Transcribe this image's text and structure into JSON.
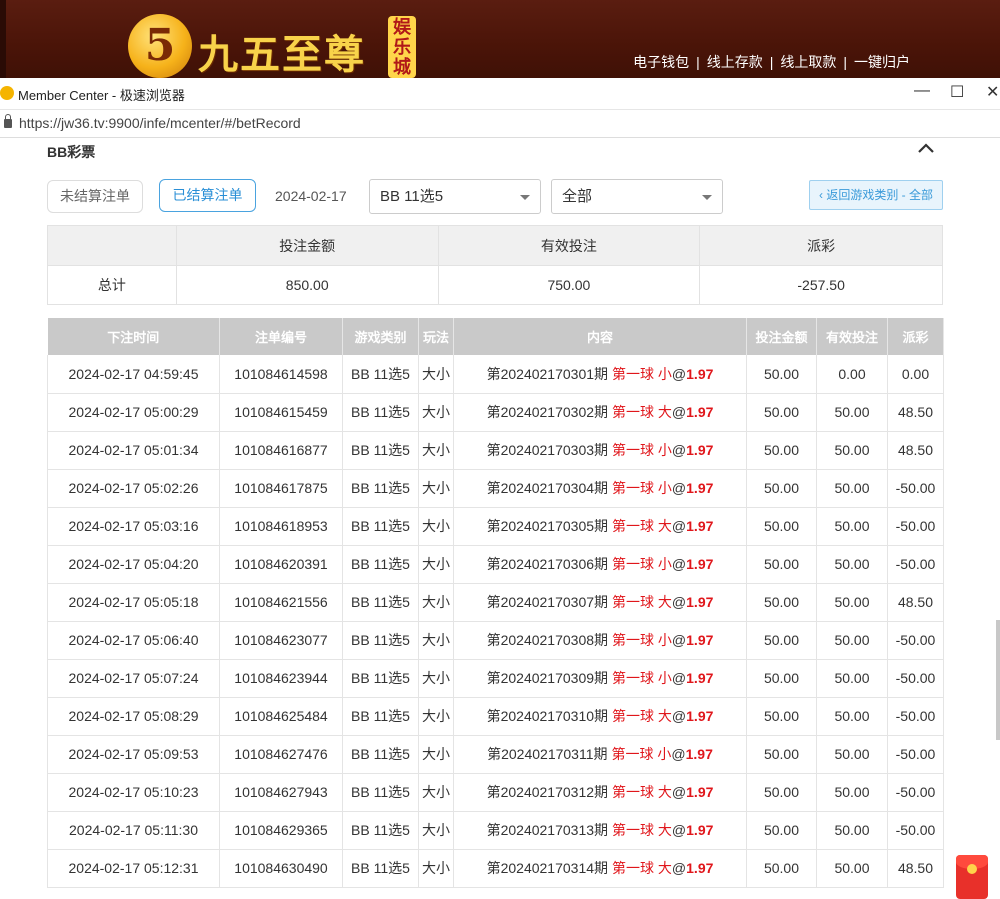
{
  "site": {
    "logo_glyph": "5",
    "brand": "九五至尊",
    "badge": "娱乐城",
    "nav": [
      "电子钱包",
      "线上存款",
      "线上取款",
      "一键归户"
    ]
  },
  "window": {
    "title": "Member Center - 极速浏览器",
    "minimize": "—",
    "maximize": "☐",
    "close": "✕",
    "url": "https://jw36.tv:9900/infe/mcenter/#/betRecord"
  },
  "section": {
    "title": "BB彩票"
  },
  "filters": {
    "unsettled_label": "未结算注单",
    "settled_label": "已结算注单",
    "date": "2024-02-17",
    "game_select": "BB 11选5",
    "type_select": "全部",
    "back_label": "‹ 返回游戏类别 - 全部"
  },
  "summary": {
    "headers": [
      "投注金额",
      "有效投注",
      "派彩"
    ],
    "row_label": "总计",
    "bet_amount": "850.00",
    "valid_bet": "750.00",
    "payout": "-257.50"
  },
  "records": {
    "headers": [
      "下注时间",
      "注单编号",
      "游戏类别",
      "玩法",
      "内容",
      "投注金额",
      "有效投注",
      "派彩"
    ],
    "rows": [
      {
        "time": "2024-02-17 04:59:45",
        "id": "101084614598",
        "game": "BB 11选5",
        "play": "大小",
        "period": "第202402170301期",
        "pick": "第一球 小",
        "odds": "1.97",
        "bet": "50.00",
        "valid": "0.00",
        "payout": "0.00"
      },
      {
        "time": "2024-02-17 05:00:29",
        "id": "101084615459",
        "game": "BB 11选5",
        "play": "大小",
        "period": "第202402170302期",
        "pick": "第一球 大",
        "odds": "1.97",
        "bet": "50.00",
        "valid": "50.00",
        "payout": "48.50"
      },
      {
        "time": "2024-02-17 05:01:34",
        "id": "101084616877",
        "game": "BB 11选5",
        "play": "大小",
        "period": "第202402170303期",
        "pick": "第一球 小",
        "odds": "1.97",
        "bet": "50.00",
        "valid": "50.00",
        "payout": "48.50"
      },
      {
        "time": "2024-02-17 05:02:26",
        "id": "101084617875",
        "game": "BB 11选5",
        "play": "大小",
        "period": "第202402170304期",
        "pick": "第一球 小",
        "odds": "1.97",
        "bet": "50.00",
        "valid": "50.00",
        "payout": "-50.00"
      },
      {
        "time": "2024-02-17 05:03:16",
        "id": "101084618953",
        "game": "BB 11选5",
        "play": "大小",
        "period": "第202402170305期",
        "pick": "第一球 大",
        "odds": "1.97",
        "bet": "50.00",
        "valid": "50.00",
        "payout": "-50.00"
      },
      {
        "time": "2024-02-17 05:04:20",
        "id": "101084620391",
        "game": "BB 11选5",
        "play": "大小",
        "period": "第202402170306期",
        "pick": "第一球 小",
        "odds": "1.97",
        "bet": "50.00",
        "valid": "50.00",
        "payout": "-50.00"
      },
      {
        "time": "2024-02-17 05:05:18",
        "id": "101084621556",
        "game": "BB 11选5",
        "play": "大小",
        "period": "第202402170307期",
        "pick": "第一球 大",
        "odds": "1.97",
        "bet": "50.00",
        "valid": "50.00",
        "payout": "48.50"
      },
      {
        "time": "2024-02-17 05:06:40",
        "id": "101084623077",
        "game": "BB 11选5",
        "play": "大小",
        "period": "第202402170308期",
        "pick": "第一球 小",
        "odds": "1.97",
        "bet": "50.00",
        "valid": "50.00",
        "payout": "-50.00"
      },
      {
        "time": "2024-02-17 05:07:24",
        "id": "101084623944",
        "game": "BB 11选5",
        "play": "大小",
        "period": "第202402170309期",
        "pick": "第一球 小",
        "odds": "1.97",
        "bet": "50.00",
        "valid": "50.00",
        "payout": "-50.00"
      },
      {
        "time": "2024-02-17 05:08:29",
        "id": "101084625484",
        "game": "BB 11选5",
        "play": "大小",
        "period": "第202402170310期",
        "pick": "第一球 大",
        "odds": "1.97",
        "bet": "50.00",
        "valid": "50.00",
        "payout": "-50.00"
      },
      {
        "time": "2024-02-17 05:09:53",
        "id": "101084627476",
        "game": "BB 11选5",
        "play": "大小",
        "period": "第202402170311期",
        "pick": "第一球 小",
        "odds": "1.97",
        "bet": "50.00",
        "valid": "50.00",
        "payout": "-50.00"
      },
      {
        "time": "2024-02-17 05:10:23",
        "id": "101084627943",
        "game": "BB 11选5",
        "play": "大小",
        "period": "第202402170312期",
        "pick": "第一球 大",
        "odds": "1.97",
        "bet": "50.00",
        "valid": "50.00",
        "payout": "-50.00"
      },
      {
        "time": "2024-02-17 05:11:30",
        "id": "101084629365",
        "game": "BB 11选5",
        "play": "大小",
        "period": "第202402170313期",
        "pick": "第一球 大",
        "odds": "1.97",
        "bet": "50.00",
        "valid": "50.00",
        "payout": "-50.00"
      },
      {
        "time": "2024-02-17 05:12:31",
        "id": "101084630490",
        "game": "BB 11选5",
        "play": "大小",
        "period": "第202402170314期",
        "pick": "第一球 大",
        "odds": "1.97",
        "bet": "50.00",
        "valid": "50.00",
        "payout": "48.50"
      }
    ]
  },
  "colors": {
    "negative": "#e0393e",
    "accent": "#2a8fd6",
    "header_bg": "#4a1408",
    "odds": "#e0161b"
  },
  "icons": {
    "collapse": "chevron-up-icon",
    "lock": "lock-icon",
    "red_packet": "red-packet-icon"
  }
}
